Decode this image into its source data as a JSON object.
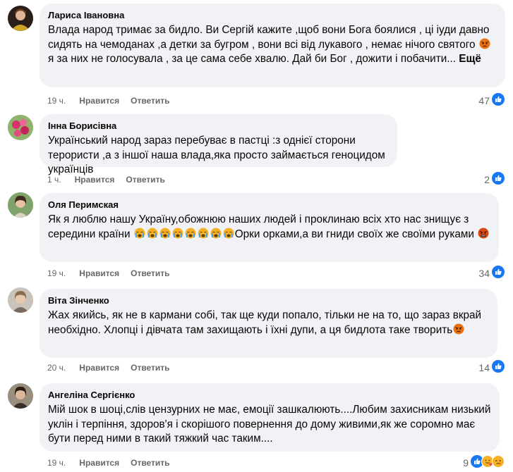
{
  "comments": [
    {
      "author": "Лариса Івановна",
      "text_parts": [
        "Влада народ тримає за бидло. Ви Сергій кажите ,щоб вони Бога боялися , ці іуди давно сидять на чемоданах ,а детки за бугром , вони всі від лукавого , немає нічого святого ",
        " я за них не голосувала , за це сама себе хвалю. Дай би Бог , дожити і побачити... "
      ],
      "more": "Ещё",
      "time": "19 ч.",
      "like": "Нравится",
      "reply": "Ответить",
      "count": "47",
      "reactions": [
        "like-icon"
      ]
    },
    {
      "author": "Інна Борисівна",
      "text": "Український народ зараз перебуває в пастці :з однієї сторони терористи ,а з іншої наша влада,яка просто займається геноцидом українців",
      "time": "1 ч.",
      "like": "Нравится",
      "reply": "Ответить",
      "count": "2",
      "reactions": [
        "like-icon"
      ]
    },
    {
      "author": "Оля Перимская",
      "text_parts": [
        "Як я люблю нашу Україну,обожнюю наших людей і проклинаю всіх хто нас знищує з середини країни ",
        "Орки орками,а ви гниди своїх же своїми руками "
      ],
      "time": "19 ч.",
      "like": "Нравится",
      "reply": "Ответить",
      "count": "34",
      "reactions": [
        "like-icon"
      ]
    },
    {
      "author": "Віта Зінченко",
      "text": "Жах якийсь, як не в кармани собі, так ще куди попало, тільки не на то, що зараз вкрай необхідно. Хлопці і дівчата там захищають і їхні дупи, а ця бидлота таке творить",
      "time": "20 ч.",
      "like": "Нравится",
      "reply": "Ответить",
      "count": "14",
      "reactions": [
        "like-icon"
      ]
    },
    {
      "author": "Ангеліна Сергієнко",
      "text": "Мій шок в шоці,слів цензурних не має, емоції зашкалюють....Любим захисникам низький уклін і терпіння, здоров'я і скорішого повернення до дому живими,як же соромно має бути перед ними в такий тяжкий час таким....",
      "time": "19 ч.",
      "like": "Нравится",
      "reply": "Ответить",
      "count": "9",
      "reactions": [
        "like-icon",
        "care-icon",
        "sad-icon"
      ]
    }
  ],
  "colors": {
    "bubble": "#f0f2f5",
    "meta": "#65676b",
    "like_blue": "#1877f2",
    "angry": "#e9710f",
    "emoji_yellow": "#f7b125"
  }
}
